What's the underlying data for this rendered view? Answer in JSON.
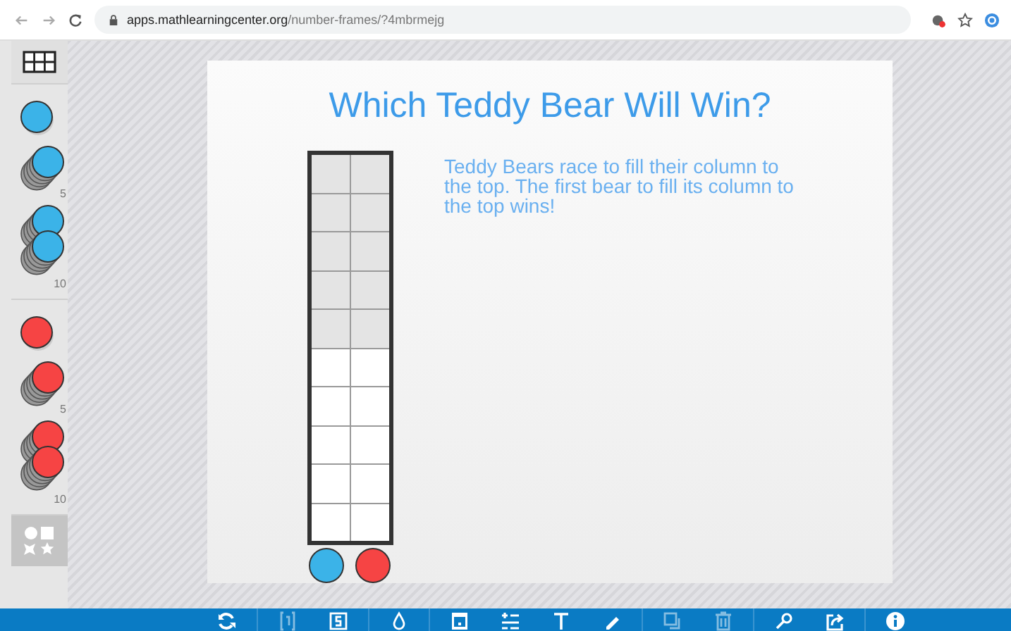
{
  "browser": {
    "url_domain": "apps.mathlearningcenter.org",
    "url_path": "/number-frames/?4mbrmejg"
  },
  "sidebar": {
    "items": [
      {
        "kind": "frame"
      },
      {
        "kind": "counter",
        "color": "#3bb3e8"
      },
      {
        "kind": "stack",
        "color": "#3bb3e8",
        "label": "5"
      },
      {
        "kind": "doublestack",
        "color": "#3bb3e8",
        "label": "10"
      },
      {
        "kind": "counter",
        "color": "#f64444"
      },
      {
        "kind": "stack",
        "color": "#f64444",
        "label": "5"
      },
      {
        "kind": "doublestack",
        "color": "#f64444",
        "label": "10"
      },
      {
        "kind": "shapes"
      }
    ]
  },
  "card": {
    "title": "Which Teddy Bear Will Win?",
    "text": "Teddy Bears race to fill their column to the top. The first bear to fill its column to the top wins!",
    "frame": {
      "rows": [
        {
          "shaded": true
        },
        {
          "shaded": true
        },
        {
          "shaded": true
        },
        {
          "shaded": true
        },
        {
          "shaded": true
        },
        {
          "shaded": false
        },
        {
          "shaded": false
        },
        {
          "shaded": false
        },
        {
          "shaded": false
        },
        {
          "shaded": false
        }
      ]
    },
    "counters": [
      {
        "color": "#3bb3e8"
      },
      {
        "color": "#f64444"
      }
    ]
  },
  "toolbar": {
    "groups": [
      [
        {
          "kind": "refresh",
          "disabled": false
        }
      ],
      [
        {
          "kind": "braces",
          "disabled": true
        },
        {
          "kind": "number",
          "disabled": false
        }
      ],
      [
        {
          "kind": "drop",
          "disabled": false
        }
      ],
      [
        {
          "kind": "card",
          "disabled": false
        },
        {
          "kind": "plusminus",
          "disabled": false
        },
        {
          "kind": "text",
          "disabled": false
        },
        {
          "kind": "pencil",
          "disabled": false
        }
      ],
      [
        {
          "kind": "duplicate",
          "disabled": true
        },
        {
          "kind": "trash",
          "disabled": true
        }
      ],
      [
        {
          "kind": "key",
          "disabled": false
        },
        {
          "kind": "share",
          "disabled": false
        }
      ],
      [
        {
          "kind": "info",
          "disabled": false
        }
      ]
    ]
  }
}
